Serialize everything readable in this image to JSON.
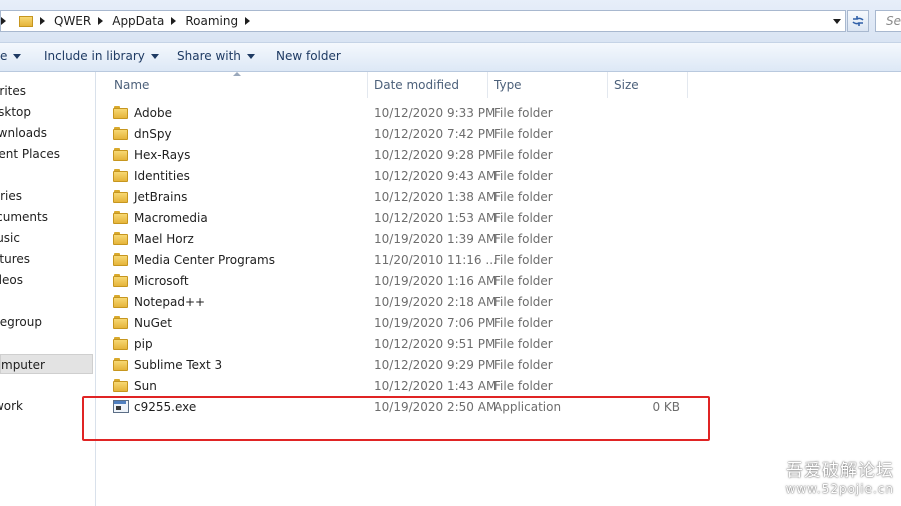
{
  "address": {
    "crumbs": [
      "QWER",
      "AppData",
      "Roaming"
    ],
    "search_placeholder": "Sea"
  },
  "toolbar": {
    "organize_label": "e",
    "include_label": "Include in library",
    "share_label": "Share with",
    "newfolder_label": "New folder"
  },
  "nav": {
    "items": [
      "rites",
      "sktop",
      "wnloads",
      "cent Places",
      "aries",
      "ocuments",
      "usic",
      "ctures",
      "deos",
      "negroup",
      "mputer",
      "work"
    ]
  },
  "columns": {
    "name": "Name",
    "date": "Date modified",
    "type": "Type",
    "size": "Size"
  },
  "files": [
    {
      "name": "Adobe",
      "date": "10/12/2020 9:33 PM",
      "type": "File folder",
      "size": "",
      "icon": "folder-icon"
    },
    {
      "name": "dnSpy",
      "date": "10/12/2020 7:42 PM",
      "type": "File folder",
      "size": "",
      "icon": "folder-icon"
    },
    {
      "name": "Hex-Rays",
      "date": "10/12/2020 9:28 PM",
      "type": "File folder",
      "size": "",
      "icon": "folder-icon"
    },
    {
      "name": "Identities",
      "date": "10/12/2020 9:43 AM",
      "type": "File folder",
      "size": "",
      "icon": "folder-icon"
    },
    {
      "name": "JetBrains",
      "date": "10/12/2020 1:38 AM",
      "type": "File folder",
      "size": "",
      "icon": "folder-icon"
    },
    {
      "name": "Macromedia",
      "date": "10/12/2020 1:53 AM",
      "type": "File folder",
      "size": "",
      "icon": "folder-icon"
    },
    {
      "name": "Mael Horz",
      "date": "10/19/2020 1:39 AM",
      "type": "File folder",
      "size": "",
      "icon": "folder-icon"
    },
    {
      "name": "Media Center Programs",
      "date": "11/20/2010 11:16 ...",
      "type": "File folder",
      "size": "",
      "icon": "folder-icon"
    },
    {
      "name": "Microsoft",
      "date": "10/19/2020 1:16 AM",
      "type": "File folder",
      "size": "",
      "icon": "folder-icon"
    },
    {
      "name": "Notepad++",
      "date": "10/19/2020 2:18 AM",
      "type": "File folder",
      "size": "",
      "icon": "folder-icon"
    },
    {
      "name": "NuGet",
      "date": "10/19/2020 7:06 PM",
      "type": "File folder",
      "size": "",
      "icon": "folder-icon"
    },
    {
      "name": "pip",
      "date": "10/12/2020 9:51 PM",
      "type": "File folder",
      "size": "",
      "icon": "folder-icon"
    },
    {
      "name": "Sublime Text 3",
      "date": "10/12/2020 9:29 PM",
      "type": "File folder",
      "size": "",
      "icon": "folder-icon"
    },
    {
      "name": "Sun",
      "date": "10/12/2020 1:43 AM",
      "type": "File folder",
      "size": "",
      "icon": "folder-icon"
    },
    {
      "name": "c9255.exe",
      "date": "10/19/2020 2:50 AM",
      "type": "Application",
      "size": "0 KB",
      "icon": "application-icon"
    }
  ],
  "watermark": {
    "line1": "吾爱破解论坛",
    "line2": "www.52pojie.cn"
  },
  "colors": {
    "annotation": "#e02424"
  }
}
